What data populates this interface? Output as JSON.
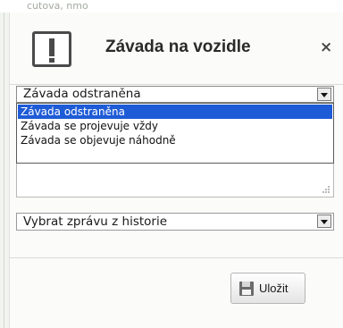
{
  "background": {
    "top_text": "cutova, nmo"
  },
  "dialog": {
    "title": "Závada na vozidle",
    "close_icon": "×",
    "icon": "alert-exclamation-icon"
  },
  "status_select": {
    "value": "Závada odstraněna",
    "options": [
      "Závada odstraněna",
      "Závada se projevuje vždy",
      "Závada se objevuje náhodně"
    ],
    "selected_index": 0
  },
  "history_select": {
    "value": "Vybrat zprávu z historie"
  },
  "save_button": {
    "label": "Uložit",
    "icon": "floppy-disk-icon"
  },
  "colors": {
    "selection": "#1e5bd6",
    "dialog_bg": "#fbfbf9"
  }
}
